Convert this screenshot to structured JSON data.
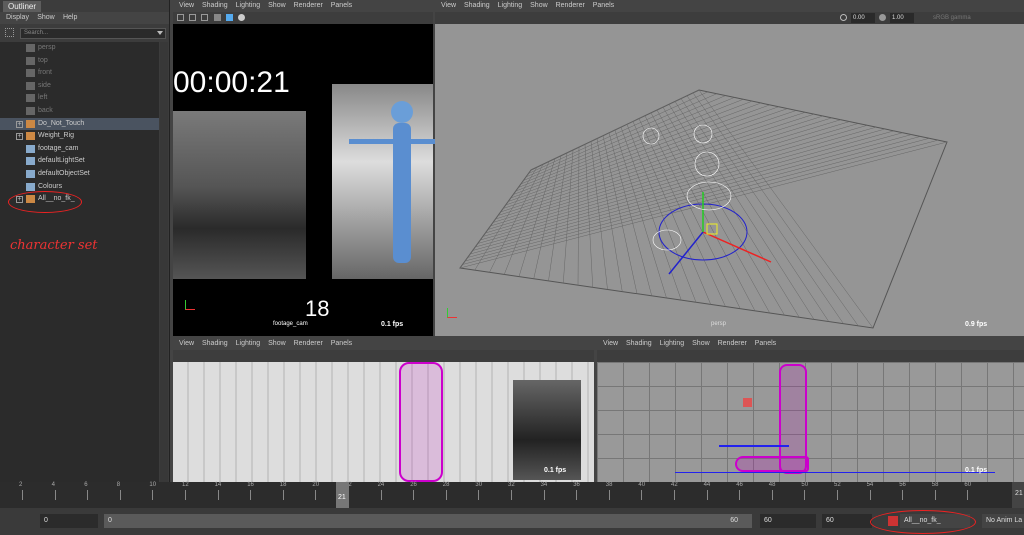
{
  "outliner": {
    "tab": "Outliner",
    "menu": [
      "Display",
      "Show",
      "Help"
    ],
    "search_placeholder": "Search...",
    "items": [
      {
        "label": "persp",
        "dim": true,
        "expandable": false
      },
      {
        "label": "top",
        "dim": true,
        "expandable": false
      },
      {
        "label": "front",
        "dim": true,
        "expandable": false
      },
      {
        "label": "side",
        "dim": true,
        "expandable": false
      },
      {
        "label": "left",
        "dim": true,
        "expandable": false
      },
      {
        "label": "back",
        "dim": true,
        "expandable": false
      },
      {
        "label": "Do_Not_Touch",
        "dim": false,
        "expandable": true
      },
      {
        "label": "Weight_Rig",
        "dim": false,
        "expandable": true
      },
      {
        "label": "footage_cam",
        "dim": false,
        "expandable": false
      },
      {
        "label": "defaultLightSet",
        "dim": false,
        "expandable": false
      },
      {
        "label": "defaultObjectSet",
        "dim": false,
        "expandable": false
      },
      {
        "label": "Colours",
        "dim": false,
        "expandable": false
      },
      {
        "label": "All__no_fk_",
        "dim": false,
        "expandable": true
      }
    ],
    "annotation": "character set"
  },
  "viewport_menu": [
    "View",
    "Shading",
    "Lighting",
    "Show",
    "Renderer",
    "Panels"
  ],
  "persp_toolbar": {
    "exposure": "0.00",
    "gamma": "1.00",
    "color_space": "sRGB gamma"
  },
  "viewports": {
    "footage": {
      "timecode": "00:00:21",
      "frame": "18",
      "camera": "footage_cam",
      "fps": "0.1 fps"
    },
    "persp": {
      "camera": "persp",
      "fps": "0.9 fps"
    },
    "bottom_left": {
      "fps": "0.1 fps"
    },
    "bottom_right": {
      "fps": "0.1 fps"
    }
  },
  "timeline": {
    "ticks": [
      "2",
      "4",
      "6",
      "8",
      "10",
      "12",
      "14",
      "16",
      "18",
      "20",
      "22",
      "24",
      "26",
      "28",
      "30",
      "32",
      "34",
      "36",
      "38",
      "40",
      "42",
      "44",
      "46",
      "48",
      "50",
      "52",
      "54",
      "56",
      "58",
      "60"
    ],
    "current_frame": "21",
    "right_label": "21"
  },
  "range": {
    "start": "0",
    "slider_start": "0",
    "slider_end": "60",
    "end": "60",
    "end2": "60",
    "character_set": "All__no_fk_",
    "anim_layer": "No Anim La"
  }
}
